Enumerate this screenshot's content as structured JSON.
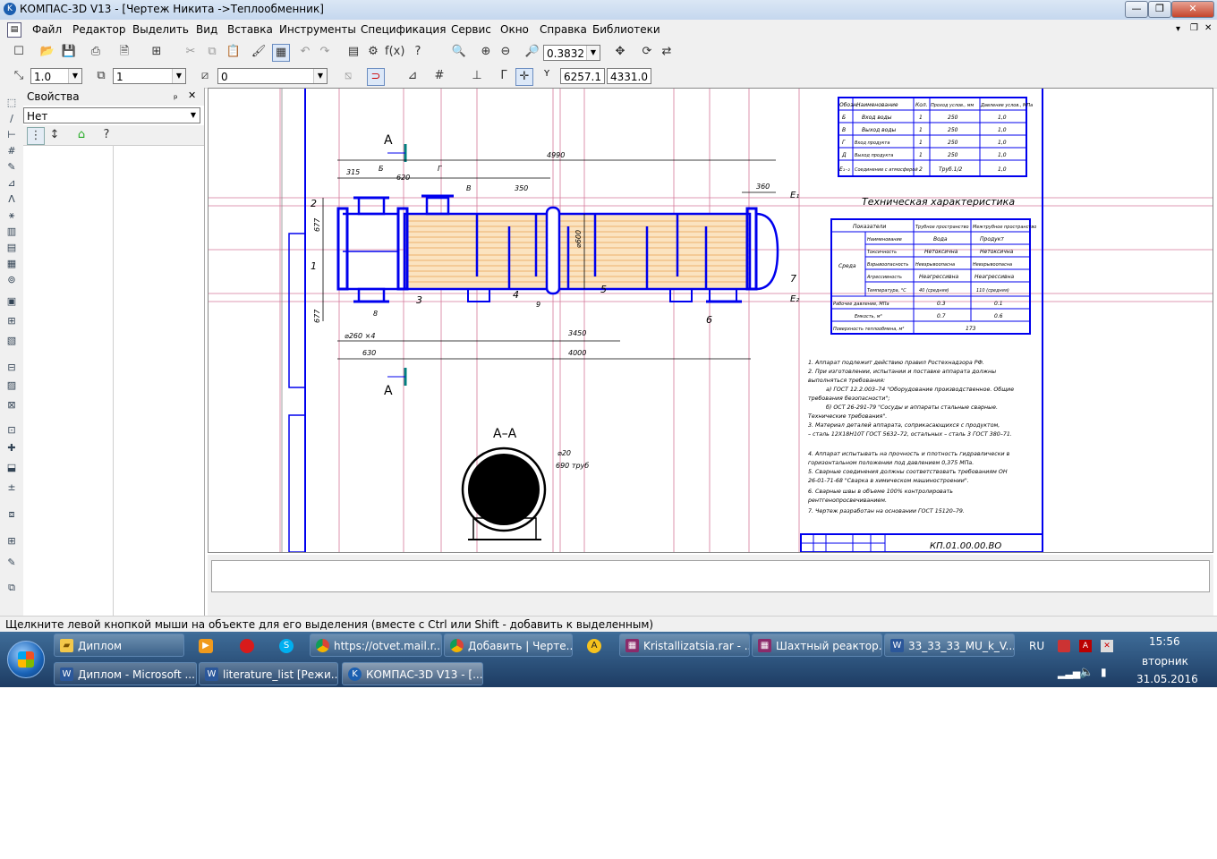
{
  "window": {
    "title": "КОМПАС-3D V13 - [Чертеж Никита ->Теплообменник]",
    "app_icon": "kompas-icon",
    "minimize": "—",
    "restore": "❐",
    "close": "✕"
  },
  "menu": {
    "items": [
      "Файл",
      "Редактор",
      "Выделить",
      "Вид",
      "Вставка",
      "Инструменты",
      "Спецификация",
      "Сервис",
      "Окно",
      "Справка",
      "Библиотеки"
    ]
  },
  "toolbar1": {
    "zoom_value": "0.3832"
  },
  "toolbar2": {
    "scale_value": "1.0",
    "layer_value": "1",
    "style_value": "0",
    "coord_x": "6257.1",
    "coord_y": "4331.0"
  },
  "properties": {
    "title": "Свойства",
    "pin": "ₚ",
    "close": "✕",
    "selector_value": "Нет"
  },
  "drawing": {
    "section_label_top": "А",
    "section_label_bottom": "А",
    "section_view_label": "А–А",
    "dims": {
      "overall": "4990",
      "d315": "315",
      "b": "Б",
      "d620": "620",
      "g": "Г",
      "v": "В",
      "d350": "350",
      "d360": "360",
      "e1": "Е₁",
      "e2": "Е₂",
      "d3450": "3450",
      "d4000": "4000",
      "d630": "630",
      "d260": "⌀260 ×4",
      "d677a": "677",
      "d677b": "677",
      "d600": "⌀600",
      "d20": "⌀20",
      "tubes": "690 труб"
    },
    "labels": [
      "1",
      "2",
      "3",
      "4",
      "5",
      "6",
      "7",
      "8",
      "9"
    ],
    "nozzle_table": {
      "headers": [
        "Обозн.",
        "Наименование",
        "Кол.",
        "Проход услов., мм",
        "Давление услов., МПа"
      ],
      "rows": [
        [
          "Б",
          "Вход воды",
          "1",
          "250",
          "1,0"
        ],
        [
          "В",
          "Выход воды",
          "1",
          "250",
          "1,0"
        ],
        [
          "Г",
          "Вход продукта",
          "1",
          "250",
          "1,0"
        ],
        [
          "Д",
          "Выход продукта",
          "1",
          "250",
          "1,0"
        ],
        [
          "Е₁₋₂",
          "Соединение с атмосферой",
          "2",
          "Труб.1/2",
          "1,0"
        ]
      ]
    },
    "tech_title": "Техническая характеристика",
    "tech_table": {
      "headers": [
        "Показатели",
        "Трубное пространство",
        "Межтрубное пространство"
      ],
      "sreda": "Среда",
      "rows": [
        [
          "Наименование",
          "Вода",
          "Продукт"
        ],
        [
          "Токсичность",
          "Нетоксична",
          "Нетоксична"
        ],
        [
          "Взрывоопасность",
          "Невзрывоопасна",
          "Невзрывоопасна"
        ],
        [
          "Агрессивность",
          "Неагрессивна",
          "Неагрессивна"
        ],
        [
          "Температура, °С",
          "40 (средняя)",
          "110 (средняя)"
        ]
      ],
      "extra": [
        [
          "Рабочее давление, МПа",
          "0.3",
          "0.1"
        ],
        [
          "Емкость, м³",
          "0.7",
          "0.6"
        ],
        [
          "Поверхность теплообмена, м²",
          "173",
          ""
        ]
      ]
    },
    "notes": [
      "1. Аппарат подлежит действию правил Ростехнадзора РФ.",
      "2. При изготовлении, испытании и поставке аппарата должны",
      "выполняться требования:",
      "а) ГОСТ 12.2.003–74 \"Оборудование производственное. Общие",
      "требования безопасности\";",
      "б) ОСТ 26-291-79 \"Сосуды и аппараты стальные сварные.",
      "Технические требования\".",
      "3. Материал деталей аппарата, соприкасающихся с продуктом,",
      "– сталь 12Х18Н10Т ГОСТ 5632–72, остальных – сталь 3 ГОСТ 380–71.",
      "4. Аппарат испытывать на прочность и плотность гидравлически в",
      "горизонтальном положении под давлением 0,375 МПа.",
      "5. Сварные соединения должны соответствовать требованиям ОН",
      "26-01-71-68 \"Сварка в химическом машиностроении\".",
      "6. Сварные швы в объеме 100% контролировать",
      "рентгенопросвечиванием.",
      "7. Чертеж разработан на основании ГОСТ 15120–79."
    ],
    "stamp_code": "КП.01.00.00.ВО"
  },
  "status_text": "Щелкните левой кнопкой мыши на объекте для его выделения (вместе с Ctrl или Shift - добавить к выделенным)",
  "taskbar": {
    "row1": [
      "Диплом",
      "https://otvet.mail.r...",
      "Добавить | Черте...",
      "Kristallizatsia.rar - ...",
      "Шахтный реактор...",
      "33_33_33_MU_k_V..."
    ],
    "row2": [
      "Диплом - Microsoft ...",
      "literature_list [Режи...",
      "КОМПАС-3D V13 - [..."
    ],
    "lang": "RU",
    "time": "15:56",
    "day": "вторник",
    "date": "31.05.2016"
  },
  "colors": {
    "drawing_blue": "#0000ee",
    "construction_pink": "#d4789a",
    "tube_orange": "#e8a050",
    "taskbar_bg": "#2b5480"
  }
}
